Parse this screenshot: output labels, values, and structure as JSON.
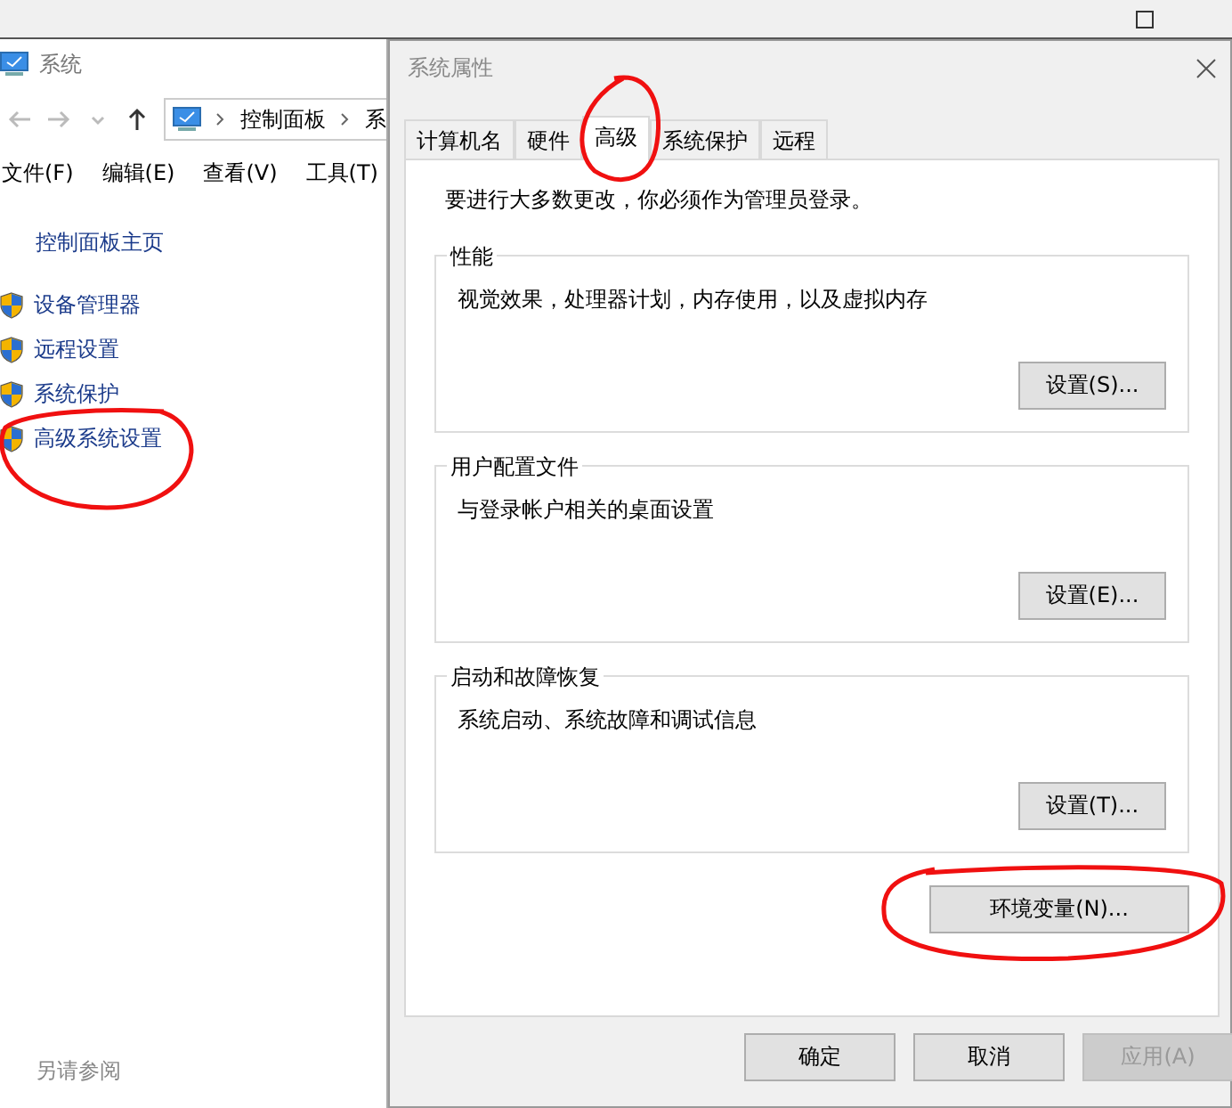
{
  "back_window": {
    "title": "系统",
    "breadcrumb": [
      "控制面板",
      "系"
    ],
    "menu": [
      "文件(F)",
      "编辑(E)",
      "查看(V)",
      "工具(T)"
    ],
    "home_link": "控制面板主页",
    "links": [
      {
        "label": "设备管理器"
      },
      {
        "label": "远程设置"
      },
      {
        "label": "系统保护"
      },
      {
        "label": "高级系统设置"
      }
    ],
    "see_also": "另请参阅"
  },
  "dialog": {
    "title": "系统属性",
    "tabs": [
      {
        "label": "计算机名",
        "selected": false
      },
      {
        "label": "硬件",
        "selected": false
      },
      {
        "label": "高级",
        "selected": true
      },
      {
        "label": "系统保护",
        "selected": false
      },
      {
        "label": "远程",
        "selected": false
      }
    ],
    "notice": "要进行大多数更改，你必须作为管理员登录。",
    "groups": [
      {
        "title": "性能",
        "description": "视觉效果，处理器计划，内存使用，以及虚拟内存",
        "button": "设置(S)..."
      },
      {
        "title": "用户配置文件",
        "description": "与登录帐户相关的桌面设置",
        "button": "设置(E)..."
      },
      {
        "title": "启动和故障恢复",
        "description": "系统启动、系统故障和调试信息",
        "button": "设置(T)..."
      }
    ],
    "env_button": "环境变量(N)...",
    "buttons": [
      {
        "label": "确定",
        "disabled": false
      },
      {
        "label": "取消",
        "disabled": false
      },
      {
        "label": "应用(A)",
        "disabled": true
      }
    ]
  }
}
